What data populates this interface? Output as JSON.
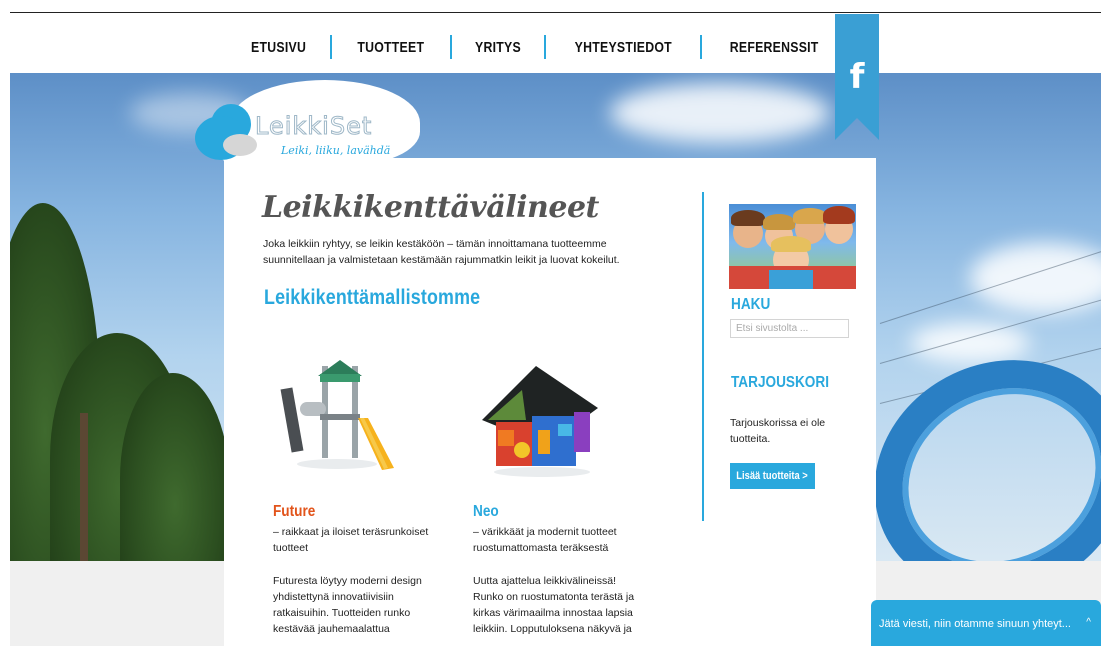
{
  "nav": {
    "items": [
      "ETUSIVU",
      "TUOTTEET",
      "YRITYS",
      "YHTEYSTIEDOT",
      "REFERENSSIT"
    ]
  },
  "social": {
    "facebook_glyph": "f",
    "icon": "facebook-icon"
  },
  "logo": {
    "name": "LeikkiSet",
    "tagline": "Leiki, liiku, lavähdä"
  },
  "page": {
    "script_title": "Leikkikenttävälineet",
    "intro": "Joka leikkiin ryhtyy, se leikin kestäköön – tämän innoittamana tuotteemme suunnitellaan ja valmistetaan kestämään rajummatkin leikit ja luovat kokeilut.",
    "section_heading": "Leikkikenttämallistomme"
  },
  "products": [
    {
      "name": "Future",
      "subtitle": "– raikkaat ja iloiset teräsrunkoiset tuotteet",
      "description": "Futuresta löytyy moderni design yhdistettynä innovatiivisiin ratkaisuihin. Tuotteiden runko kestävää jauhemaalattua"
    },
    {
      "name": "Neo",
      "subtitle": "– värikkäät ja modernit tuotteet ruostumattomasta teräksestä",
      "description": "Uutta ajattelua leikkivälineissä! Runko on ruostumatonta terästä ja kirkas värimaailma innostaa lapsia leikkiin. Lopputuloksena näkyvä ja"
    }
  ],
  "sidebar": {
    "search_heading": "HAKU",
    "search_placeholder": "Etsi sivustolta ...",
    "cart_heading": "TARJOUSKORI",
    "cart_empty": "Tarjouskorissa ei ole tuotteita.",
    "add_button": "Lisää tuotteita >"
  },
  "chat": {
    "label": "Jätä viesti, niin otamme sinuun yhteyt...",
    "chevron": "^"
  },
  "colors": {
    "accent": "#29a8dd",
    "future": "#e2541b",
    "neo": "#29a8dd"
  }
}
